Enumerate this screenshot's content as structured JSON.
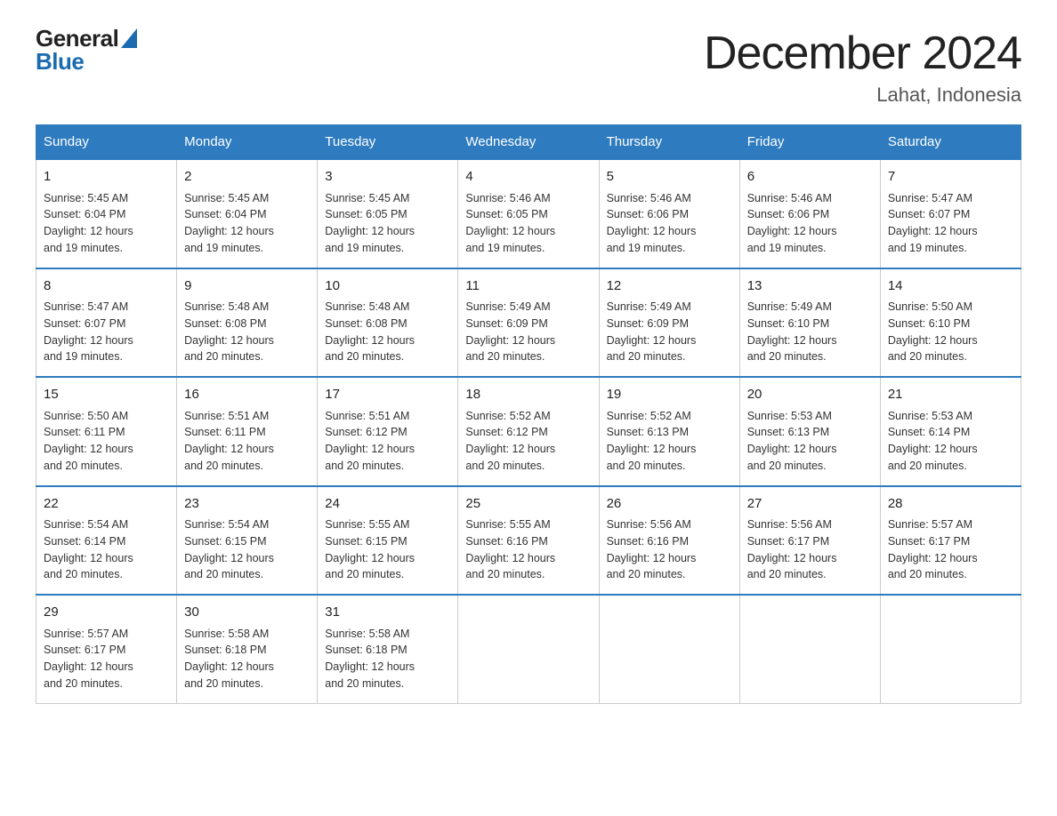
{
  "header": {
    "logo_general": "General",
    "logo_blue": "Blue",
    "title": "December 2024",
    "subtitle": "Lahat, Indonesia"
  },
  "weekdays": [
    "Sunday",
    "Monday",
    "Tuesday",
    "Wednesday",
    "Thursday",
    "Friday",
    "Saturday"
  ],
  "weeks": [
    [
      {
        "day": "1",
        "sunrise": "5:45 AM",
        "sunset": "6:04 PM",
        "daylight": "12 hours and 19 minutes."
      },
      {
        "day": "2",
        "sunrise": "5:45 AM",
        "sunset": "6:04 PM",
        "daylight": "12 hours and 19 minutes."
      },
      {
        "day": "3",
        "sunrise": "5:45 AM",
        "sunset": "6:05 PM",
        "daylight": "12 hours and 19 minutes."
      },
      {
        "day": "4",
        "sunrise": "5:46 AM",
        "sunset": "6:05 PM",
        "daylight": "12 hours and 19 minutes."
      },
      {
        "day": "5",
        "sunrise": "5:46 AM",
        "sunset": "6:06 PM",
        "daylight": "12 hours and 19 minutes."
      },
      {
        "day": "6",
        "sunrise": "5:46 AM",
        "sunset": "6:06 PM",
        "daylight": "12 hours and 19 minutes."
      },
      {
        "day": "7",
        "sunrise": "5:47 AM",
        "sunset": "6:07 PM",
        "daylight": "12 hours and 19 minutes."
      }
    ],
    [
      {
        "day": "8",
        "sunrise": "5:47 AM",
        "sunset": "6:07 PM",
        "daylight": "12 hours and 19 minutes."
      },
      {
        "day": "9",
        "sunrise": "5:48 AM",
        "sunset": "6:08 PM",
        "daylight": "12 hours and 20 minutes."
      },
      {
        "day": "10",
        "sunrise": "5:48 AM",
        "sunset": "6:08 PM",
        "daylight": "12 hours and 20 minutes."
      },
      {
        "day": "11",
        "sunrise": "5:49 AM",
        "sunset": "6:09 PM",
        "daylight": "12 hours and 20 minutes."
      },
      {
        "day": "12",
        "sunrise": "5:49 AM",
        "sunset": "6:09 PM",
        "daylight": "12 hours and 20 minutes."
      },
      {
        "day": "13",
        "sunrise": "5:49 AM",
        "sunset": "6:10 PM",
        "daylight": "12 hours and 20 minutes."
      },
      {
        "day": "14",
        "sunrise": "5:50 AM",
        "sunset": "6:10 PM",
        "daylight": "12 hours and 20 minutes."
      }
    ],
    [
      {
        "day": "15",
        "sunrise": "5:50 AM",
        "sunset": "6:11 PM",
        "daylight": "12 hours and 20 minutes."
      },
      {
        "day": "16",
        "sunrise": "5:51 AM",
        "sunset": "6:11 PM",
        "daylight": "12 hours and 20 minutes."
      },
      {
        "day": "17",
        "sunrise": "5:51 AM",
        "sunset": "6:12 PM",
        "daylight": "12 hours and 20 minutes."
      },
      {
        "day": "18",
        "sunrise": "5:52 AM",
        "sunset": "6:12 PM",
        "daylight": "12 hours and 20 minutes."
      },
      {
        "day": "19",
        "sunrise": "5:52 AM",
        "sunset": "6:13 PM",
        "daylight": "12 hours and 20 minutes."
      },
      {
        "day": "20",
        "sunrise": "5:53 AM",
        "sunset": "6:13 PM",
        "daylight": "12 hours and 20 minutes."
      },
      {
        "day": "21",
        "sunrise": "5:53 AM",
        "sunset": "6:14 PM",
        "daylight": "12 hours and 20 minutes."
      }
    ],
    [
      {
        "day": "22",
        "sunrise": "5:54 AM",
        "sunset": "6:14 PM",
        "daylight": "12 hours and 20 minutes."
      },
      {
        "day": "23",
        "sunrise": "5:54 AM",
        "sunset": "6:15 PM",
        "daylight": "12 hours and 20 minutes."
      },
      {
        "day": "24",
        "sunrise": "5:55 AM",
        "sunset": "6:15 PM",
        "daylight": "12 hours and 20 minutes."
      },
      {
        "day": "25",
        "sunrise": "5:55 AM",
        "sunset": "6:16 PM",
        "daylight": "12 hours and 20 minutes."
      },
      {
        "day": "26",
        "sunrise": "5:56 AM",
        "sunset": "6:16 PM",
        "daylight": "12 hours and 20 minutes."
      },
      {
        "day": "27",
        "sunrise": "5:56 AM",
        "sunset": "6:17 PM",
        "daylight": "12 hours and 20 minutes."
      },
      {
        "day": "28",
        "sunrise": "5:57 AM",
        "sunset": "6:17 PM",
        "daylight": "12 hours and 20 minutes."
      }
    ],
    [
      {
        "day": "29",
        "sunrise": "5:57 AM",
        "sunset": "6:17 PM",
        "daylight": "12 hours and 20 minutes."
      },
      {
        "day": "30",
        "sunrise": "5:58 AM",
        "sunset": "6:18 PM",
        "daylight": "12 hours and 20 minutes."
      },
      {
        "day": "31",
        "sunrise": "5:58 AM",
        "sunset": "6:18 PM",
        "daylight": "12 hours and 20 minutes."
      },
      null,
      null,
      null,
      null
    ]
  ],
  "labels": {
    "sunrise": "Sunrise:",
    "sunset": "Sunset:",
    "daylight": "Daylight:"
  }
}
